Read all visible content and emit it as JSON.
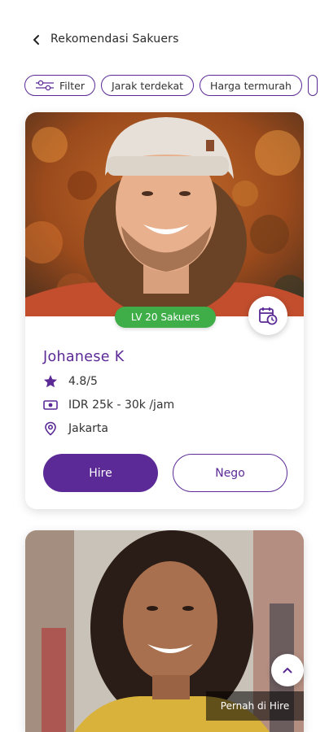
{
  "header": {
    "title": "Rekomendasi Sakuers"
  },
  "filters": {
    "filter_label": "Filter",
    "chips": [
      "Jarak terdekat",
      "Harga termurah"
    ]
  },
  "cards": [
    {
      "level_badge": "LV 20 Sakuers",
      "name": "Johanese K",
      "rating": "4.8/5",
      "price": "IDR 25k - 30k /jam",
      "location": "Jakarta",
      "hire_label": "Hire",
      "nego_label": "Nego"
    },
    {
      "status_label": "Pernah di Hire"
    }
  ],
  "colors": {
    "primary": "#5b2a96",
    "badge_green": "#3fae49"
  },
  "icons": [
    "back-arrow-icon",
    "filter-sliders-icon",
    "calendar-clock-icon",
    "star-icon",
    "money-icon",
    "location-pin-icon",
    "chevron-up-icon"
  ]
}
